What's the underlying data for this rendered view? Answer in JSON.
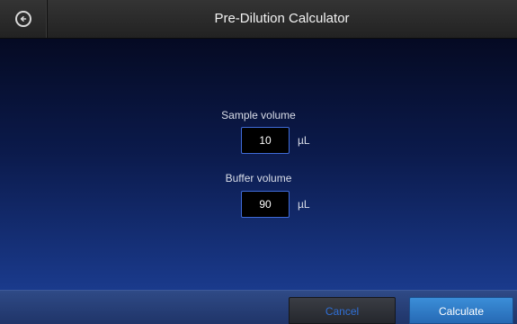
{
  "header": {
    "title": "Pre-Dilution Calculator",
    "back_icon": "back-arrow-icon"
  },
  "form": {
    "sample_volume": {
      "label": "Sample volume",
      "value": "10",
      "unit": "µL"
    },
    "buffer_volume": {
      "label": "Buffer volume",
      "value": "90",
      "unit": "µL"
    }
  },
  "footer": {
    "cancel_label": "Cancel",
    "calculate_label": "Calculate"
  },
  "colors": {
    "accent": "#2f6fd6",
    "primary_button": "#2f7cc7",
    "background_top": "#050a23",
    "background_bottom": "#1a3a8c"
  }
}
